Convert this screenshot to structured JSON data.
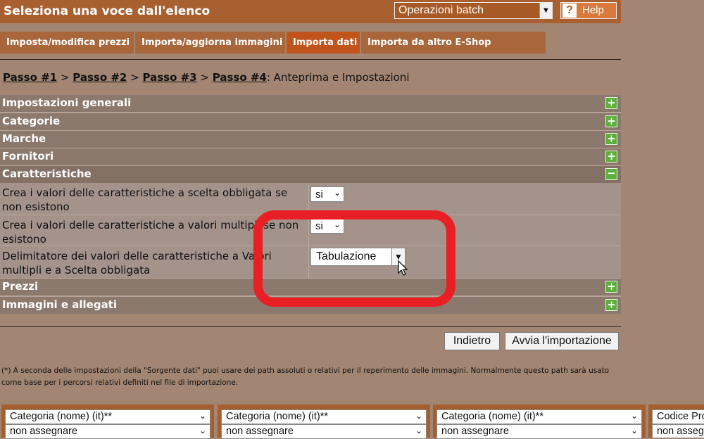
{
  "header": {
    "title": "Seleziona una voce dall'elenco",
    "batch_select": "Operazioni batch",
    "help_label": "Help"
  },
  "tabs": [
    {
      "label": "Imposta/modifica prezzi",
      "active": false
    },
    {
      "label": "Importa/aggiorna immagini",
      "active": false
    },
    {
      "label": "Importa dati",
      "active": true
    },
    {
      "label": "Importa da altro E-Shop",
      "active": false
    }
  ],
  "breadcrumb": {
    "steps": [
      "Passo #1",
      "Passo #2",
      "Passo #3",
      "Passo #4"
    ],
    "separator": ">",
    "current": ": Anteprima e Impostazioni"
  },
  "sections": {
    "general": {
      "label": "Impostazioni generali",
      "toggle": "+"
    },
    "categories": {
      "label": "Categorie",
      "toggle": "+"
    },
    "brands": {
      "label": "Marche",
      "toggle": "+"
    },
    "suppliers": {
      "label": "Fornitori",
      "toggle": "+"
    },
    "features": {
      "label": "Caratteristiche",
      "toggle": "−"
    },
    "prices": {
      "label": "Prezzi",
      "toggle": "+"
    },
    "images": {
      "label": "Immagini e allegati",
      "toggle": "+"
    }
  },
  "feature_rows": [
    {
      "label": "Crea i valori delle caratteristiche a scelta obbligata se non esistono",
      "value": "si"
    },
    {
      "label": "Crea i valori delle caratteristiche a valori multipli se non esistono",
      "value": "si"
    },
    {
      "label": "Delimitatore dei valori delle caratteristiche a Valori multipli e a Scelta obbligata",
      "value": "Tabulazione"
    }
  ],
  "buttons": {
    "back": "Indietro",
    "start": "Avvia l'importazione"
  },
  "note": "(*) A seconda delle impostazioni della \"Sorgente dati\" puoi usare dei path assoluti o relativi per il reperimento delle immagini. Normalmente questo path sarà usato come base per i percorsi relativi definiti nel file di importazione.",
  "mapping_columns": [
    {
      "field": "Categoria (nome) (it)**",
      "assign": "non assegnare"
    },
    {
      "field": "Categoria (nome) (it)**",
      "assign": "non assegnare"
    },
    {
      "field": "Categoria (nome) (it)**",
      "assign": "non assegnare"
    },
    {
      "field": "Codice Prodotto",
      "assign": "non assegnare"
    }
  ],
  "colors": {
    "header_bg": "#a86030",
    "active_tab": "#c0541a",
    "toggle_green": "#5eae3d",
    "highlight_red": "#e82026"
  }
}
